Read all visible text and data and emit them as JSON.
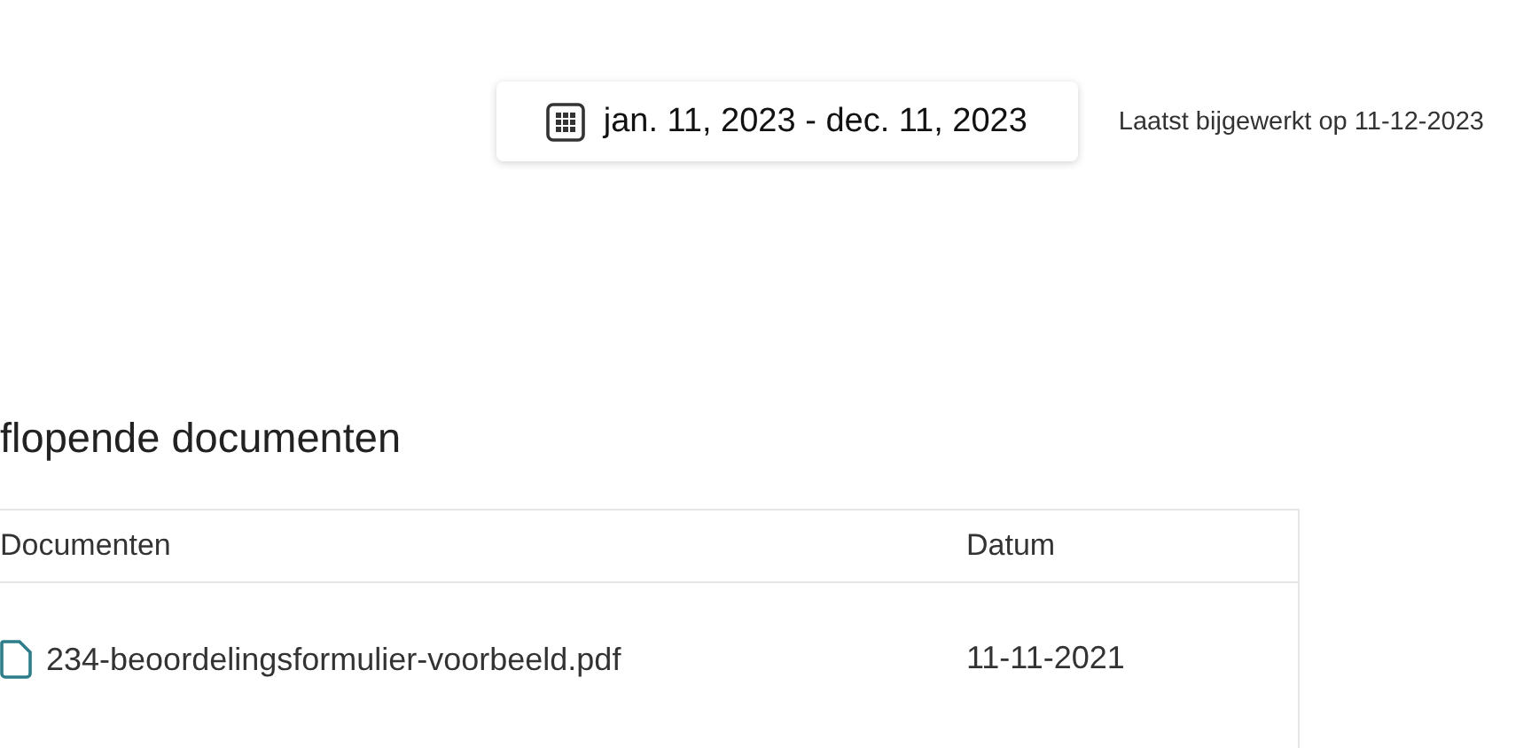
{
  "date_range": {
    "label": "jan. 11, 2023 - dec. 11, 2023"
  },
  "last_updated": "Laatst bijgewerkt op 11-12-2023",
  "section_title": "flopende documenten",
  "table": {
    "columns": [
      "Documenten",
      "Datum"
    ],
    "rows": [
      {
        "name": "234-beoordelingsformulier-voorbeeld.pdf",
        "date": "11-11-2021"
      }
    ]
  }
}
